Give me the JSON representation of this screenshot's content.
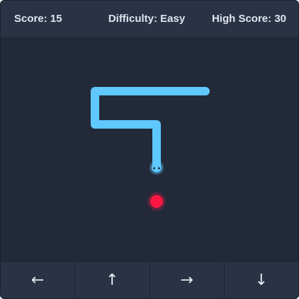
{
  "header": {
    "score_label": "Score: 15",
    "difficulty_label": "Difficulty: Easy",
    "high_score_label": "High Score: 30"
  },
  "game": {
    "snake_color": "#5ec8ff",
    "food_color": "#ff1744",
    "board_color": "#222a3a"
  },
  "controls": {
    "left": "←",
    "up": "↑",
    "right": "→",
    "down": "↓"
  }
}
